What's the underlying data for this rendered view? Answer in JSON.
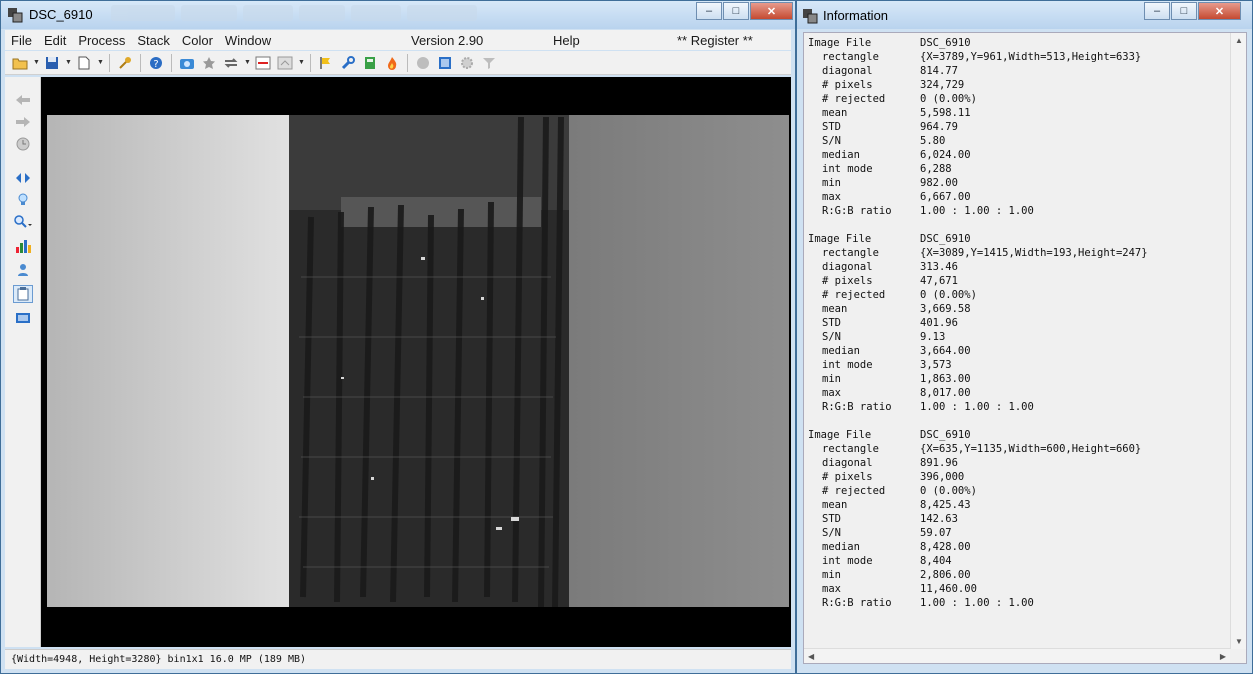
{
  "main_window": {
    "title": "DSC_6910",
    "background_tabs": [
      "\u0000",
      "\u0000",
      "\u0000",
      "\u0000",
      "\u0000",
      "\u0000"
    ],
    "controls": {
      "minimize": "–",
      "maximize": "□",
      "close": "✕"
    },
    "menu": {
      "items": [
        "File",
        "Edit",
        "Process",
        "Stack",
        "Color",
        "Window"
      ],
      "version": "Version 2.90",
      "help": "Help",
      "register": "** Register **"
    },
    "toolbar_icons": [
      "open-folder-icon",
      "save-icon",
      "new-document-icon",
      "key-icon",
      "help-icon",
      "camera-icon",
      "star-icon",
      "rotate-icon",
      "red-line-icon",
      "stack-icon",
      "flag-icon",
      "wrench-icon",
      "calculator-icon",
      "flame-icon",
      "circle-icon",
      "frame-icon",
      "gear-icon",
      "filter-icon"
    ],
    "side_icons": [
      "back-arrow-icon",
      "forward-arrow-icon",
      "clock-icon",
      "split-arrows-icon",
      "bulb-icon",
      "zoom-icon",
      "histogram-icon",
      "person-icon",
      "notepad-icon",
      "monitor-icon"
    ],
    "status": "{Width=4948, Height=3280} bin1x1  16.0 MP (189 MB)"
  },
  "info_window": {
    "title": "Information",
    "controls": {
      "minimize": "–",
      "maximize": "□",
      "close": "✕"
    },
    "blocks": [
      {
        "image_file": "DSC_6910",
        "rectangle": "{X=3789,Y=961,Width=513,Height=633}",
        "diagonal": "814.77",
        "pixels": "324,729",
        "rejected": "0 (0.00%)",
        "mean": "5,598.11",
        "std": "964.79",
        "sn": "5.80",
        "median": "6,024.00",
        "int_mode": "6,288",
        "min": "982.00",
        "max": "6,667.00",
        "rgb_ratio": "1.00 : 1.00 : 1.00"
      },
      {
        "image_file": "DSC_6910",
        "rectangle": "{X=3089,Y=1415,Width=193,Height=247}",
        "diagonal": "313.46",
        "pixels": "47,671",
        "rejected": "0 (0.00%)",
        "mean": "3,669.58",
        "std": "401.96",
        "sn": "9.13",
        "median": "3,664.00",
        "int_mode": "3,573",
        "min": "1,863.00",
        "max": "8,017.00",
        "rgb_ratio": "1.00 : 1.00 : 1.00"
      },
      {
        "image_file": "DSC_6910",
        "rectangle": "{X=635,Y=1135,Width=600,Height=660}",
        "diagonal": "891.96",
        "pixels": "396,000",
        "rejected": "0 (0.00%)",
        "mean": "8,425.43",
        "std": "142.63",
        "sn": "59.07",
        "median": "8,428.00",
        "int_mode": "8,404",
        "min": "2,806.00",
        "max": "11,460.00",
        "rgb_ratio": "1.00 : 1.00 : 1.00"
      }
    ],
    "labels": {
      "image_file": "Image File",
      "rectangle": "rectangle",
      "diagonal": "diagonal",
      "pixels": "# pixels",
      "rejected": "# rejected",
      "mean": "mean",
      "std": "STD",
      "sn": "S/N",
      "median": "median",
      "int_mode": "int mode",
      "min": "min",
      "max": "max",
      "rgb_ratio": "R:G:B ratio"
    }
  }
}
